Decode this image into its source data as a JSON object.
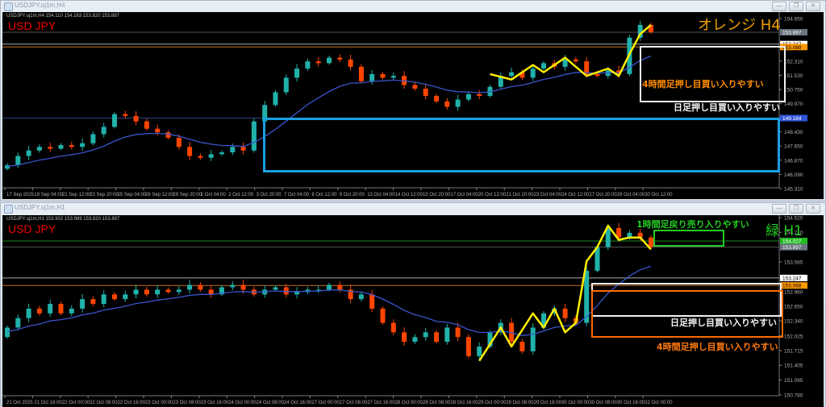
{
  "windows": [
    {
      "title": "USDJPY.oj1m,H4",
      "info": "USDJPY.oj1m,H4  154.110 154.163 153.820 153.897",
      "symbol_label": "USD JPY",
      "tf_label": "オレンジ H4",
      "annotations": {
        "orange_text": "4時間足押し目買い入りやすい",
        "white_text": "日足押し目買い入りやすい"
      }
    },
    {
      "title": "USDJPY.oj1m,H1",
      "info": "USDJPY.oj1m,H1  153.902 153.969 153.820 153.897",
      "symbol_label": "USD JPY",
      "tf_label": "緑 H1",
      "annotations": {
        "green_text": "1時間足戻り売り入りやすい",
        "white_text": "日足押し目買い入りやすい",
        "orange_text": "4時間足押し目買い入りやすい"
      }
    }
  ],
  "window_buttons": {
    "minimize": "—",
    "restore": "❐",
    "close": "✕"
  },
  "colors": {
    "bull": "#20b2aa",
    "bear": "#ff4500",
    "ma": "#3a55cc",
    "zigzag": "#ffee00",
    "grid_text": "#b0b0b0"
  },
  "chart_data": [
    {
      "type": "candlestick",
      "title": "USDJPY.oj1m,H4",
      "ylim": [
        145.31,
        154.65
      ],
      "yticks": [
        "154.650",
        "152.310",
        "151.530",
        "150.750",
        "149.970",
        "149.190",
        "148.430",
        "147.650",
        "146.870",
        "146.090",
        "145.310"
      ],
      "xticks": [
        "17 Sep 2025",
        "19 Sep 04:00",
        "22 Sep 12:00",
        "23 Sep 20:00",
        "25 Sep 04:00",
        "26 Sep 12:00",
        "29 Sep 20:00",
        "1 Oct 04:00",
        "2 Oct 12:00",
        "3 Oct 20:00",
        "7 Oct 04:00",
        "8 Oct 12:00",
        "9 Oct 20:00",
        "13 Oct 04:00",
        "14 Oct 12:00",
        "15 Oct 20:00",
        "17 Oct 04:00",
        "20 Oct 12:00",
        "21 Oct 20:00",
        "23 Oct 04:00",
        "24 Oct 12:00",
        "27 Oct 20:00",
        "29 Oct 04:00",
        "30 Oct 12:00"
      ],
      "closes": [
        146.6,
        147.1,
        147.4,
        147.6,
        147.5,
        147.7,
        147.6,
        147.8,
        148.3,
        148.7,
        149.4,
        149.3,
        149.0,
        148.6,
        148.4,
        148.1,
        147.6,
        147.1,
        147.0,
        147.2,
        147.3,
        147.6,
        147.4,
        149.0,
        149.9,
        150.6,
        151.4,
        151.9,
        152.3,
        152.2,
        152.5,
        152.4,
        152.0,
        151.2,
        151.6,
        151.4,
        151.5,
        151.0,
        150.8,
        150.4,
        150.1,
        149.8,
        150.2,
        150.5,
        150.4,
        150.9,
        151.5,
        151.7,
        151.4,
        151.9,
        152.2,
        152.0,
        152.4,
        152.3,
        151.6,
        151.5,
        151.8,
        151.6,
        153.6,
        154.3,
        153.9
      ],
      "hlines": [
        {
          "price": 153.897,
          "label": "153.897",
          "color": "#555555",
          "label_bg": "#6b7380",
          "label_fg": "#ffffff"
        },
        {
          "price": 153.247,
          "label": "153.247",
          "color": "#aaaaaa",
          "label_bg": "#ffffff",
          "label_fg": "#000000"
        },
        {
          "price": 153.088,
          "label": "153.088",
          "color": "#c07020",
          "label_bg": "#ff9900",
          "label_fg": "#000000"
        },
        {
          "price": 149.184,
          "label": "149.184",
          "color": "#2b3f8c",
          "label_bg": "#3355dd",
          "label_fg": "#ffffff"
        }
      ],
      "zigzag": [
        [
          45,
          151.6
        ],
        [
          47,
          151.3
        ],
        [
          49,
          152.1
        ],
        [
          50,
          151.7
        ],
        [
          52,
          152.5
        ],
        [
          54,
          151.5
        ],
        [
          56,
          151.9
        ],
        [
          57,
          151.5
        ],
        [
          58,
          152.7
        ],
        [
          59,
          153.8
        ],
        [
          60,
          154.3
        ]
      ]
    },
    {
      "type": "candlestick",
      "title": "USDJPY.oj1m,H1",
      "ylim": [
        150.78,
        154.52
      ],
      "yticks": [
        "154.520",
        "154.210",
        "153.585",
        "152.960",
        "152.650",
        "152.340",
        "152.025",
        "151.715",
        "151.405",
        "151.095",
        "150.780"
      ],
      "xticks": [
        "21 Oct 2025",
        "21 Oct 16:00",
        "22 Oct 00:00",
        "22 Oct 08:00",
        "22 Oct 16:00",
        "23 Oct 00:00",
        "23 Oct 08:00",
        "23 Oct 16:00",
        "24 Oct 00:00",
        "24 Oct 08:00",
        "24 Oct 16:00",
        "27 Oct 00:00",
        "27 Oct 08:00",
        "27 Oct 16:00",
        "28 Oct 00:00",
        "28 Oct 08:00",
        "28 Oct 16:00",
        "29 Oct 00:00",
        "29 Oct 08:00",
        "29 Oct 16:00",
        "30 Oct 00:00",
        "30 Oct 08:00",
        "30 Oct 16:00",
        "31 Oct 00:00"
      ],
      "closes": [
        152.2,
        152.4,
        152.6,
        152.5,
        152.7,
        152.5,
        152.6,
        152.8,
        152.7,
        152.9,
        152.8,
        152.9,
        153.0,
        152.9,
        153.0,
        152.95,
        153.0,
        153.1,
        153.0,
        152.9,
        153.05,
        153.1,
        153.0,
        152.9,
        153.0,
        153.05,
        152.9,
        152.95,
        153.0,
        153.0,
        153.1,
        153.0,
        152.8,
        152.9,
        152.6,
        152.3,
        152.1,
        151.9,
        152.0,
        152.1,
        151.9,
        152.2,
        152.0,
        151.6,
        151.8,
        152.1,
        152.3,
        151.9,
        151.7,
        152.2,
        152.5,
        152.6,
        152.4,
        152.3,
        153.4,
        153.9,
        154.3,
        154.1,
        154.2,
        154.1,
        153.9
      ],
      "hlines": [
        {
          "price": 154.027,
          "label": "154.027",
          "color": "#1a8a1a",
          "label_bg": "#22bb22",
          "label_fg": "#ffffff"
        },
        {
          "price": 153.897,
          "label": "153.897",
          "color": "#555555",
          "label_bg": "#6b7380",
          "label_fg": "#ffffff"
        },
        {
          "price": 153.247,
          "label": "153.247",
          "color": "#aaaaaa",
          "label_bg": "#ffffff",
          "label_fg": "#000000"
        },
        {
          "price": 153.088,
          "label": "153.088",
          "color": "#c07020",
          "label_bg": "#ff9900",
          "label_fg": "#000000"
        }
      ],
      "zigzag": [
        [
          44,
          151.5
        ],
        [
          46,
          152.2
        ],
        [
          47,
          151.8
        ],
        [
          49,
          152.5
        ],
        [
          50,
          152.2
        ],
        [
          51,
          152.6
        ],
        [
          52,
          152.1
        ],
        [
          53,
          152.3
        ],
        [
          54,
          153.6
        ],
        [
          55,
          153.9
        ],
        [
          56,
          154.35
        ],
        [
          57,
          154.05
        ],
        [
          58,
          154.1
        ],
        [
          59,
          154.1
        ],
        [
          60,
          153.85
        ]
      ]
    }
  ]
}
